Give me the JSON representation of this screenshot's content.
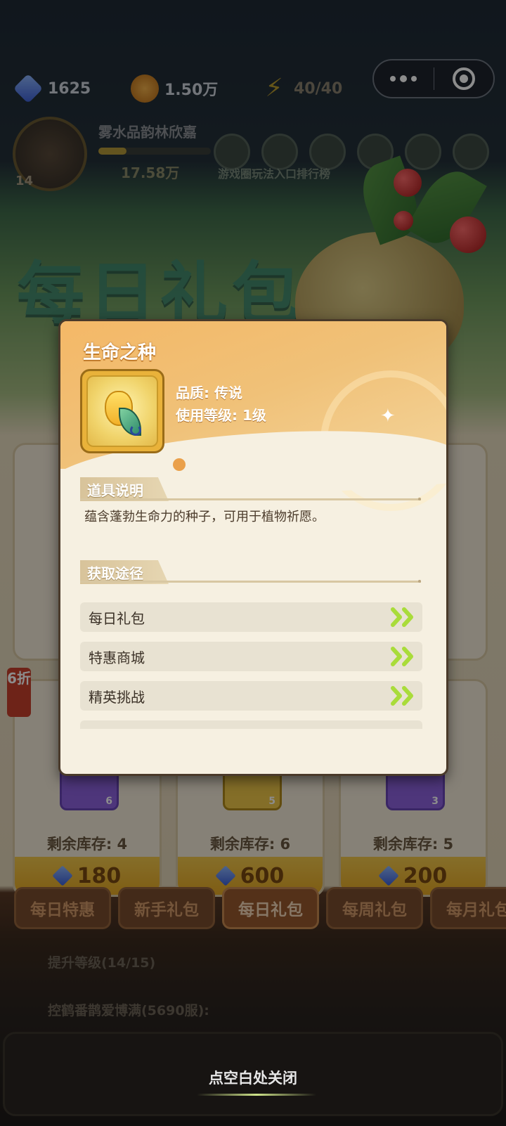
{
  "topbar": {
    "gems": "1625",
    "gold": "1.50万",
    "energy": "40/40"
  },
  "player": {
    "name": "雾水品韵林欣嘉",
    "power": "17.58万",
    "level": "14"
  },
  "hub": {
    "labels": "游戏圈玩法入口排行榜"
  },
  "banner": {
    "title": "每日礼包"
  },
  "shop_cards": [
    {
      "stock": "剩余库存: 4",
      "price": "180",
      "item_count": "6"
    },
    {
      "stock": "剩余库存: 6",
      "price": "600",
      "item_count": "5"
    },
    {
      "stock": "剩余库存: 5",
      "price": "200",
      "item_count": "3"
    }
  ],
  "discount_badge": "6折",
  "tabs": [
    "每日特惠",
    "新手礼包",
    "每日礼包",
    "每周礼包",
    "每月礼包"
  ],
  "active_tab": "每日礼包",
  "tasks": {
    "upgrade": "提升等级(14/15)",
    "server": "控鹤番鹊爱博满(5690服):"
  },
  "modal": {
    "item_name": "生命之种",
    "quality": "品质: 传说",
    "use_level": "使用等级: 1级",
    "desc_section": "道具说明",
    "description": "蕴含蓬勃生命力的种子，可用于植物祈愿。",
    "source_section": "获取途径",
    "sources": [
      "每日礼包",
      "特惠商城",
      "精英挑战"
    ]
  },
  "close_hint": "点空白处关闭",
  "colors": {
    "accent_orange": "#f4b867",
    "tab_active": "#9a5a2e",
    "arrow_green": "#a9dc3a"
  }
}
